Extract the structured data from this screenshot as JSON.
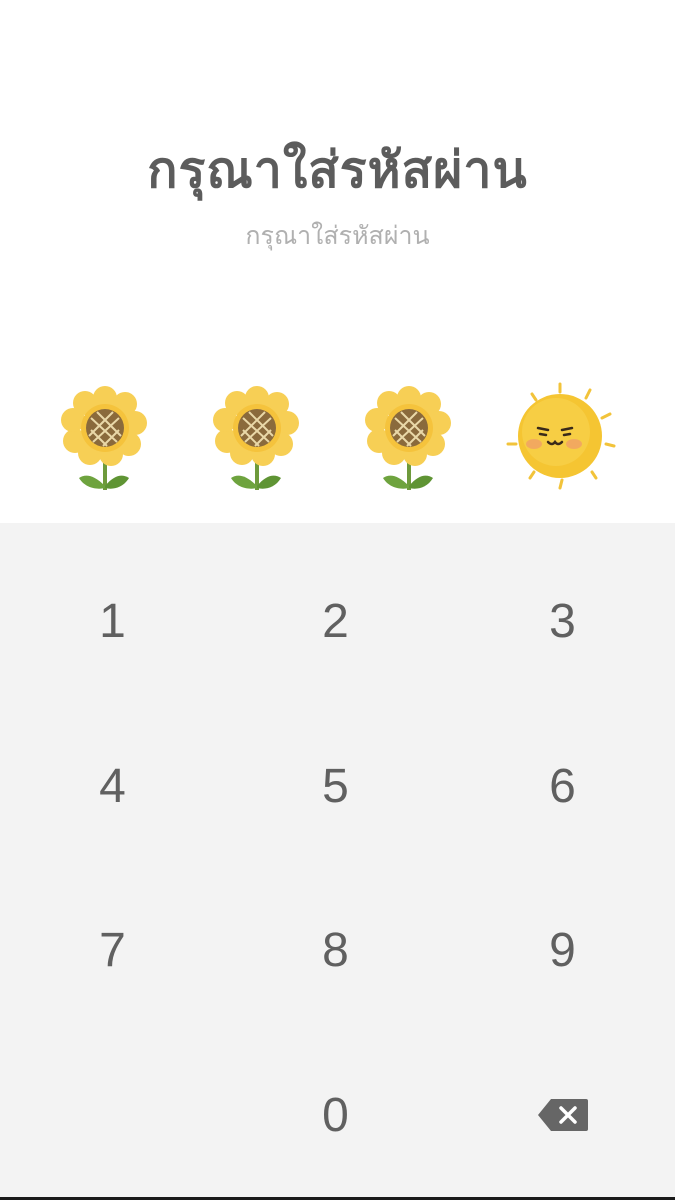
{
  "header": {
    "title": "กรุณาใส่รหัสผ่าน",
    "subtitle": "กรุณาใส่รหัสผ่าน"
  },
  "pin": {
    "entered": 3,
    "length": 4,
    "filled_icon": "sunflower-icon",
    "empty_icon": "sun-icon"
  },
  "keypad": {
    "keys": [
      "1",
      "2",
      "3",
      "4",
      "5",
      "6",
      "7",
      "8",
      "9",
      "",
      "0",
      "backspace"
    ],
    "backspace_icon": "backspace-icon"
  },
  "colors": {
    "keypad_bg": "#f3f3f3",
    "petal": "#f7cf55",
    "sun": "#f5c532"
  }
}
